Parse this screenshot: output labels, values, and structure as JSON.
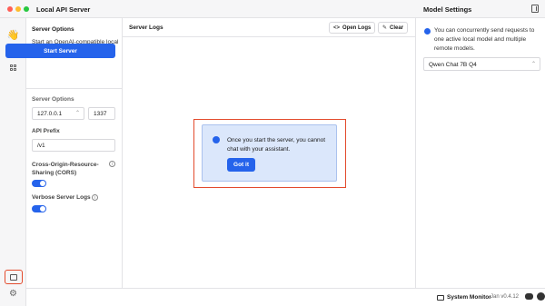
{
  "window": {
    "title": "Local API Server",
    "right_panel_title": "Model Settings"
  },
  "sidebar": {
    "icons": [
      "hand-wave-icon",
      "chat-icon",
      "grid-icon",
      "server-icon",
      "gear-icon"
    ]
  },
  "left_panel": {
    "section_title": "Server Options",
    "description": "Start an OpenAI-compatible local HTTP server.",
    "start_button": "Start Server",
    "options_label": "Server Options",
    "host_value": "127.0.0.1",
    "port_value": "1337",
    "api_prefix_label": "API Prefix",
    "api_prefix_value": "/v1",
    "cors_label": "Cross-Origin-Resource-Sharing (CORS)",
    "cors_enabled": true,
    "verbose_label": "Verbose Server Logs",
    "verbose_enabled": true
  },
  "center": {
    "title": "Server Logs",
    "open_logs_label": "Open Logs",
    "clear_label": "Clear",
    "popup_text": "Once you start the server, you cannot chat with your assistant.",
    "popup_button": "Got it"
  },
  "right_panel": {
    "notice": "You can concurrently send requests to one active local model and multiple remote models.",
    "model_selected": "Qwen Chat 7B Q4"
  },
  "status_bar": {
    "system_monitor_label": "System Monitor",
    "version": "Jan v0.4.12"
  },
  "colors": {
    "accent": "#2563eb",
    "highlight_frame": "#e34b2d",
    "popup_bg": "#dbe7fb"
  }
}
